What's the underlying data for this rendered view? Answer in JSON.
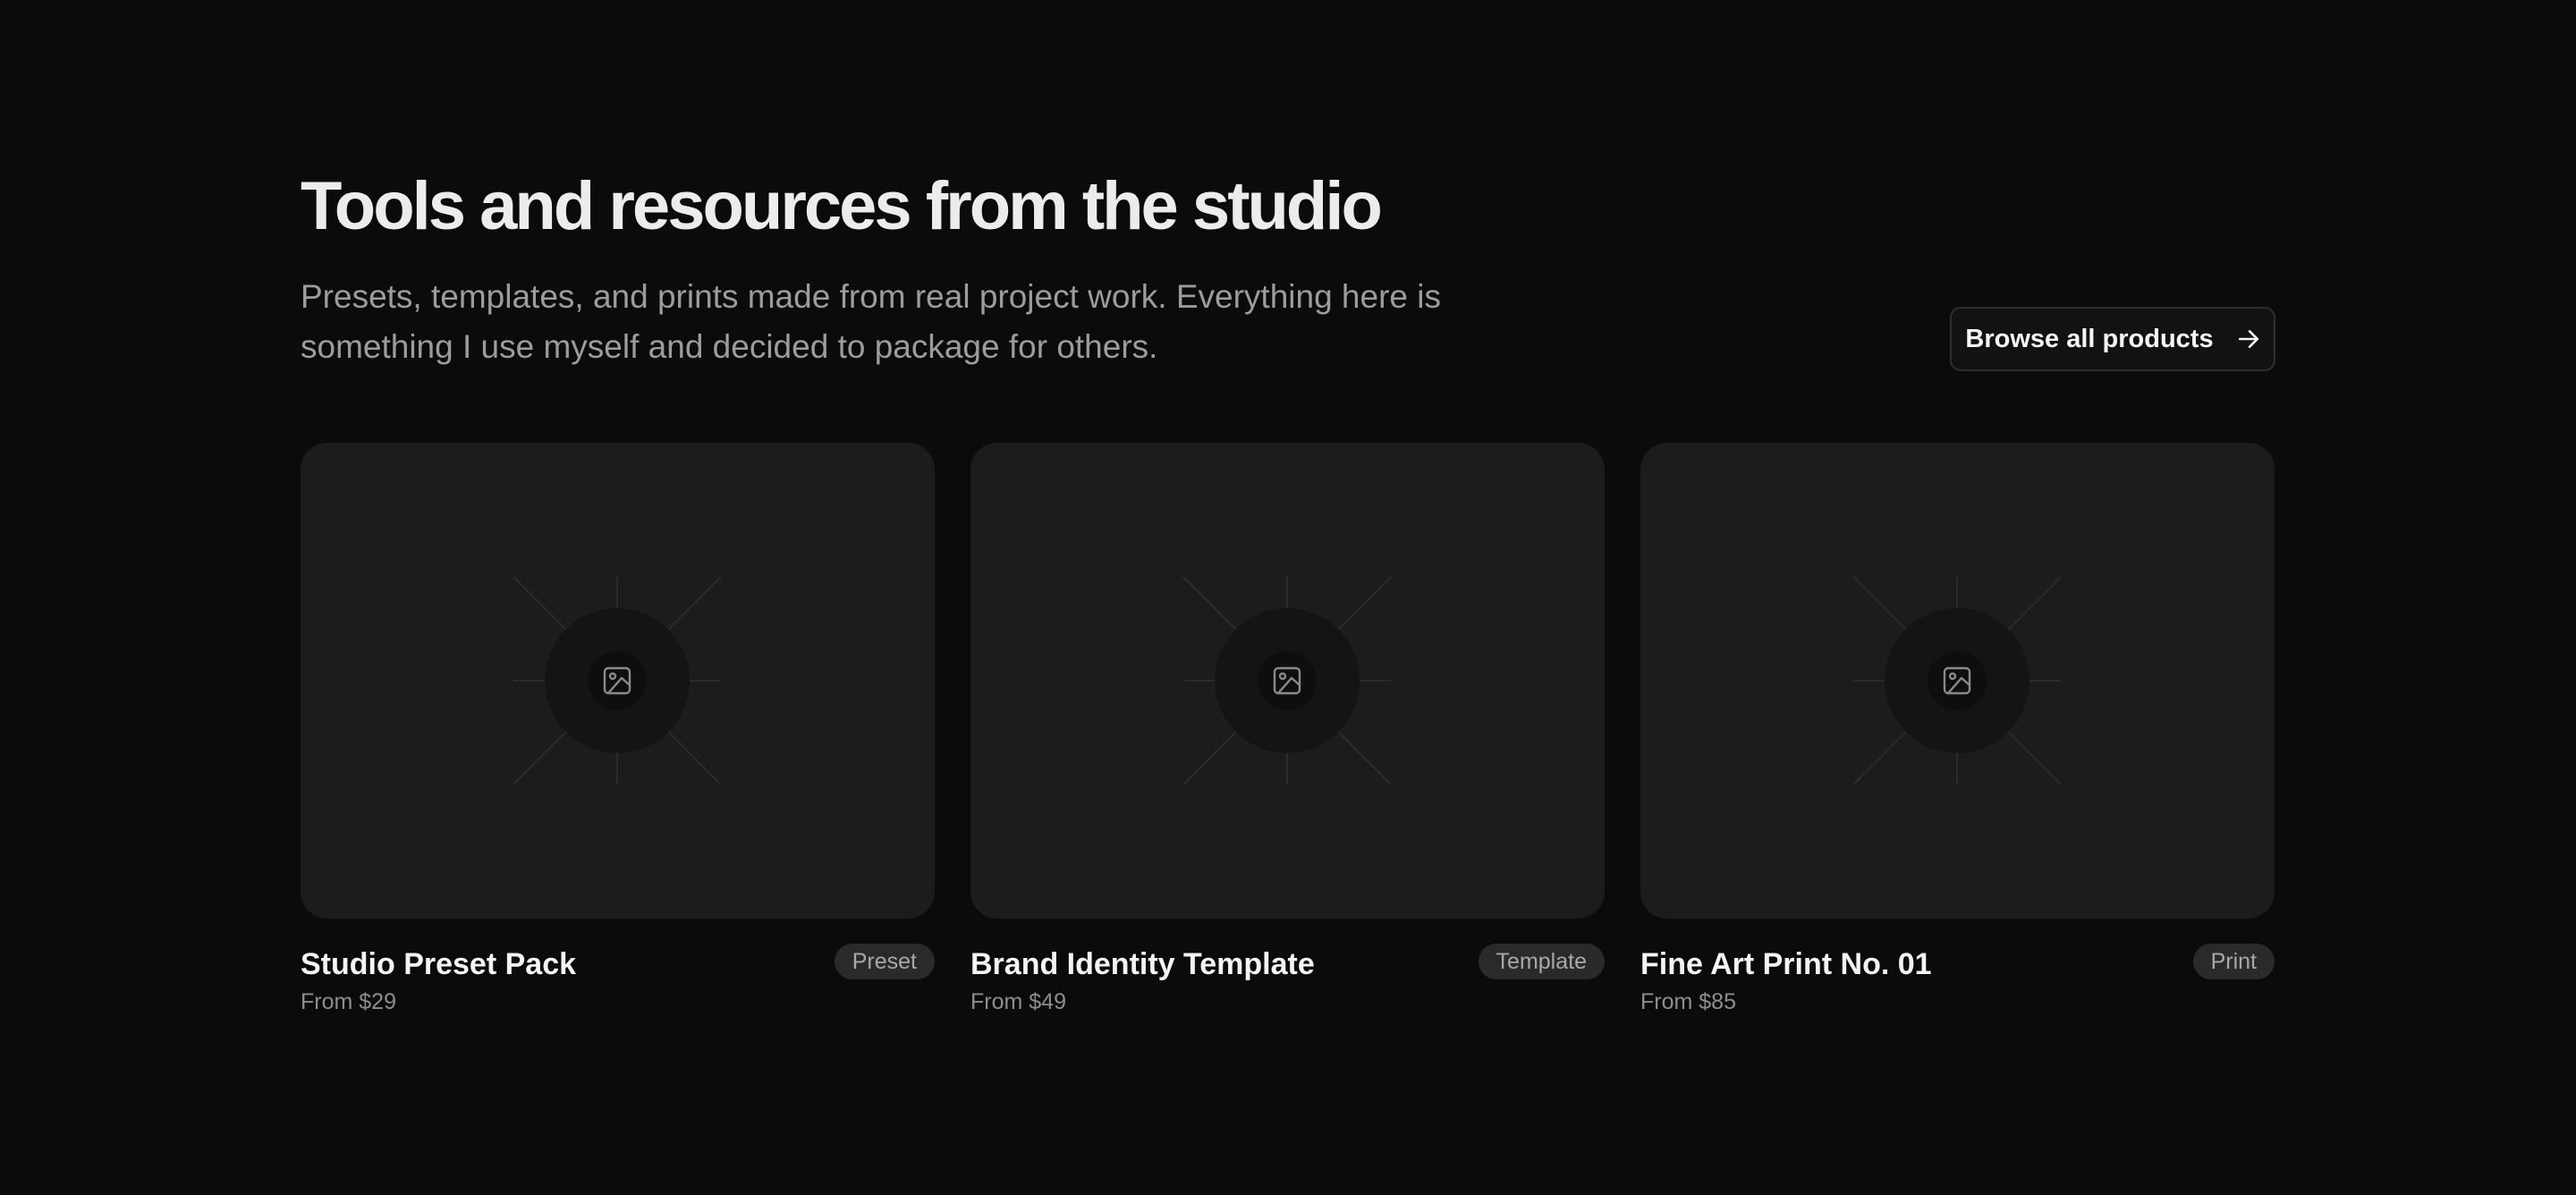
{
  "header": {
    "title": "Tools and resources from the studio",
    "subtitle": "Presets, templates, and prints made from real project work. Everything here is something I use myself and decided to package for others.",
    "browse_label": "Browse all products",
    "browse_icon": "arrow-right-icon"
  },
  "products": [
    {
      "title": "Studio Preset Pack",
      "price": "From $29",
      "badge": "Preset",
      "image_icon": "image-placeholder-icon"
    },
    {
      "title": "Brand Identity Template",
      "price": "From $49",
      "badge": "Template",
      "image_icon": "image-placeholder-icon"
    },
    {
      "title": "Fine Art Print No. 01",
      "price": "From $85",
      "badge": "Print",
      "image_icon": "image-placeholder-icon"
    }
  ],
  "colors": {
    "background": "#0b0b0b",
    "card_background": "#1c1c1c",
    "badge_background": "#2a2a2a",
    "muted_text": "#9c9c9c"
  }
}
